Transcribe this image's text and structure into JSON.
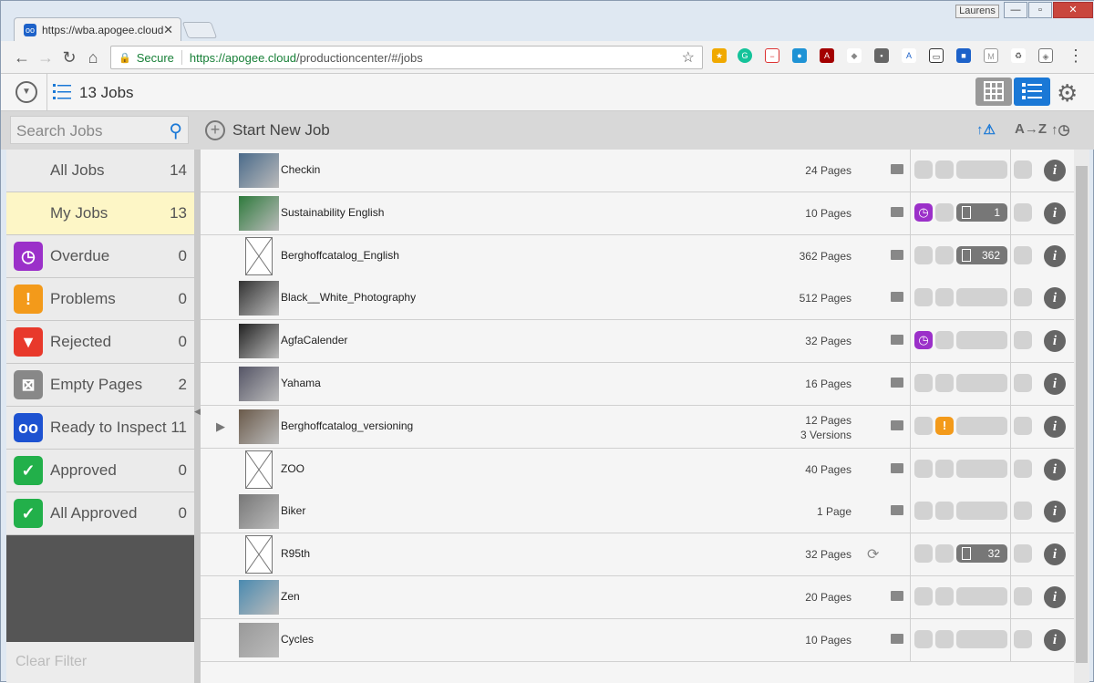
{
  "browser": {
    "tab_title": "https://wba.apogee.cloud",
    "user": "Laurens",
    "secure_label": "Secure",
    "url_host": "https://apogee.cloud",
    "url_path": "/productioncenter/#/jobs"
  },
  "header": {
    "job_count": "13 Jobs"
  },
  "toolbar": {
    "search_placeholder": "Search Jobs",
    "start_new_job": "Start New Job",
    "sort_problems": "↑⚠",
    "sort_az": "A→Z",
    "sort_time": "↑◷"
  },
  "filters": [
    {
      "label": "All Jobs",
      "count": "14",
      "icon": "none"
    },
    {
      "label": "My Jobs",
      "count": "13",
      "icon": "none",
      "selected": true
    },
    {
      "label": "Overdue",
      "count": "0",
      "icon": "clock-icon",
      "color": "#9b30c9"
    },
    {
      "label": "Problems",
      "count": "0",
      "icon": "warning-icon",
      "color": "#f39a1a"
    },
    {
      "label": "Rejected",
      "count": "0",
      "icon": "thumbs-down-icon",
      "color": "#e8392b"
    },
    {
      "label": "Empty Pages",
      "count": "2",
      "icon": "empty-page-icon",
      "color": "#888888"
    },
    {
      "label": "Ready to Inspect",
      "count": "11",
      "icon": "glasses-icon",
      "color": "#1d52d1"
    },
    {
      "label": "Approved",
      "count": "0",
      "icon": "check-icon",
      "color": "#22b04a"
    },
    {
      "label": "All Approved",
      "count": "0",
      "icon": "folder-check-icon",
      "color": "#22b04a"
    }
  ],
  "clear_filter": "Clear Filter",
  "jobs": [
    {
      "name": "Checkin",
      "pages": "24 Pages",
      "thumb": "photo"
    },
    {
      "name": "Sustainability English",
      "pages": "10 Pages",
      "thumb": "photo",
      "overdue": true,
      "empty_count": "1"
    },
    {
      "name": "Berghoffcatalog_English",
      "pages": "362 Pages",
      "thumb": "placeholder",
      "empty_count": "362"
    },
    {
      "name": "Black__White_Photography",
      "pages": "512 Pages",
      "thumb": "photo"
    },
    {
      "name": "AgfaCalender",
      "pages": "32 Pages",
      "thumb": "photo",
      "overdue": true
    },
    {
      "name": "Yahama",
      "pages": "16 Pages",
      "thumb": "photo"
    },
    {
      "name": "Berghoffcatalog_versioning",
      "pages": "12 Pages",
      "versions": "3 Versions",
      "thumb": "photo",
      "problem": true
    },
    {
      "name": "ZOO",
      "pages": "40 Pages",
      "thumb": "placeholder"
    },
    {
      "name": "Biker",
      "pages": "1 Page",
      "thumb": "photo"
    },
    {
      "name": "R95th",
      "pages": "32 Pages",
      "thumb": "placeholder",
      "sync": true,
      "empty_count": "32"
    },
    {
      "name": "Zen",
      "pages": "20 Pages",
      "thumb": "photo"
    },
    {
      "name": "Cycles",
      "pages": "10 Pages",
      "thumb": "photo"
    }
  ]
}
